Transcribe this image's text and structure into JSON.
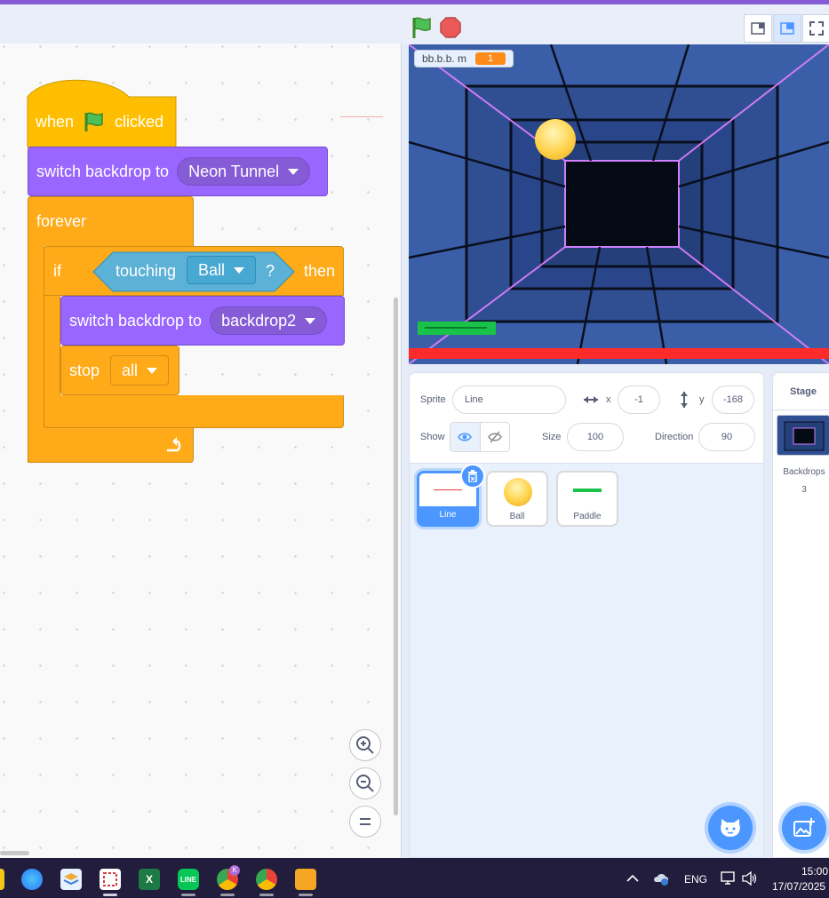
{
  "toolbar": {
    "green_flag_icon": "green-flag-icon",
    "stop_icon": "stop-sign-icon",
    "layout_buttons": [
      "small-stage-icon",
      "normal-stage-icon",
      "fullscreen-icon"
    ]
  },
  "script": {
    "hat": {
      "when": "when",
      "clicked": "clicked"
    },
    "switch1": {
      "label": "switch backdrop to",
      "value": "Neon Tunnel"
    },
    "forever": {
      "label": "forever"
    },
    "if_block": {
      "if": "if",
      "touching": "touching",
      "object": "Ball",
      "q": "?",
      "then": "then"
    },
    "switch2": {
      "label": "switch backdrop to",
      "value": "backdrop2"
    },
    "stop": {
      "label": "stop",
      "value": "all"
    }
  },
  "stage": {
    "variable_name": "bb.b.b. m",
    "variable_value": "1"
  },
  "sprite_info": {
    "sprite_label": "Sprite",
    "sprite_name": "Line",
    "x_label": "x",
    "x_value": "-1",
    "y_label": "y",
    "y_value": "-168",
    "show_label": "Show",
    "size_label": "Size",
    "size_value": "100",
    "direction_label": "Direction",
    "direction_value": "90"
  },
  "sprites": [
    {
      "name": "Line"
    },
    {
      "name": "Ball"
    },
    {
      "name": "Paddle"
    }
  ],
  "stage_pane": {
    "title": "Stage",
    "backdrops_label": "Backdrops",
    "backdrops_count": "3"
  },
  "taskbar": {
    "lang": "ENG",
    "time": "15:00",
    "date": "17/07/2025"
  },
  "colors": {
    "events": "#ffbf00",
    "looks": "#9966ff",
    "control": "#ffab19",
    "sensing": "#5cb1d6",
    "accent": "#4c97ff"
  }
}
